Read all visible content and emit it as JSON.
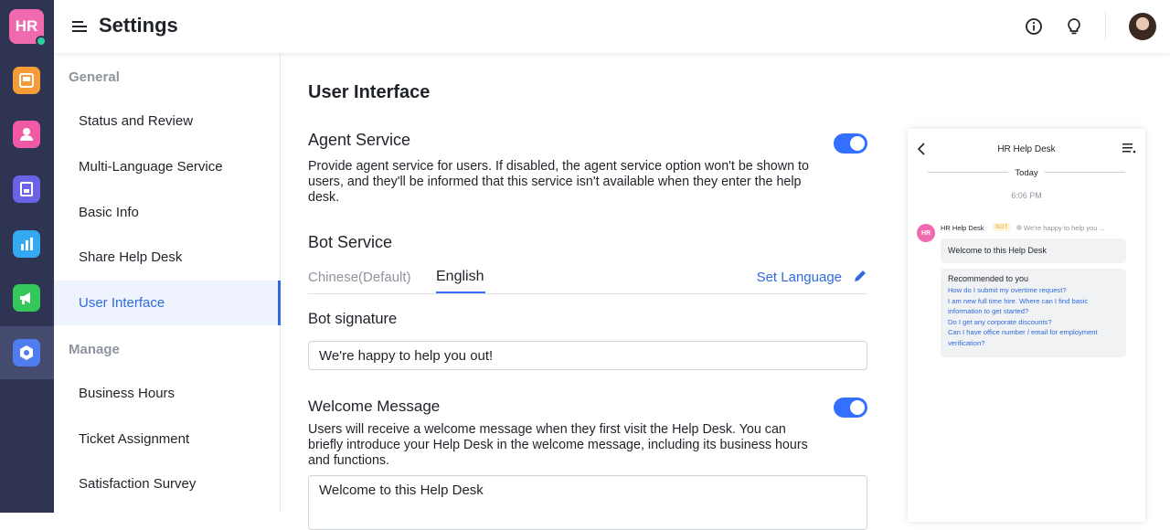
{
  "app": {
    "logo_text": "HR",
    "title": "Settings"
  },
  "rail": {
    "apps": [
      {
        "name": "tickets",
        "icon": "inbox-icon",
        "color": "#f59b38"
      },
      {
        "name": "contacts",
        "icon": "user-icon",
        "color": "#f05aa4"
      },
      {
        "name": "knowledge",
        "icon": "book-icon",
        "color": "#6b63e6"
      },
      {
        "name": "analytics",
        "icon": "bar-chart-icon",
        "color": "#33a9f2"
      },
      {
        "name": "announcements",
        "icon": "megaphone-icon",
        "color": "#34c759"
      },
      {
        "name": "settings",
        "icon": "gear-icon",
        "color": "#4f7df0"
      }
    ]
  },
  "nav": {
    "general_label": "General",
    "manage_label": "Manage",
    "general_items": [
      "Status and Review",
      "Multi-Language Service",
      "Basic Info",
      "Share Help Desk",
      "User Interface"
    ],
    "manage_items": [
      "Business Hours",
      "Ticket Assignment",
      "Satisfaction Survey"
    ],
    "active_item": "User Interface"
  },
  "main": {
    "section_title": "User Interface",
    "agent_service": {
      "title": "Agent Service",
      "description": "Provide agent service for users. If disabled, the agent service option won't be shown to users, and they'll be informed that this service isn't available when they enter the help desk.",
      "enabled": true
    },
    "bot_service": {
      "title": "Bot Service",
      "tabs": [
        "Chinese(Default)",
        "English"
      ],
      "active_tab": "English",
      "set_language": "Set Language",
      "signature_label": "Bot signature",
      "signature_value": "We're happy to help you out!"
    },
    "welcome_message": {
      "title": "Welcome Message",
      "description": "Users will receive a welcome message when they first visit the Help Desk. You can briefly introduce your Help Desk in the welcome message, including its business hours and functions.",
      "enabled": true,
      "value": "Welcome to this Help Desk"
    }
  },
  "preview": {
    "title": "HR Help Desk",
    "date_divider": "Today",
    "time": "6:06 PM",
    "avatar_text": "HR",
    "sender_name": "HR Help Desk",
    "bot_badge": "BOT",
    "signature_preview": "We're happy to help you ...",
    "welcome": "Welcome to this Help Desk",
    "recommended_title": "Recommended to you",
    "questions": [
      "How do I submit my overtime request?",
      "I am new full time hire. Where can I find basic information to get started?",
      "Do I get any corporate discounts?",
      "Can I have office number / email for employment verification?"
    ]
  },
  "colors": {
    "accent": "#3370ff",
    "rail_bg": "#2f3453",
    "active_nav_bg": "#eef3fd"
  }
}
